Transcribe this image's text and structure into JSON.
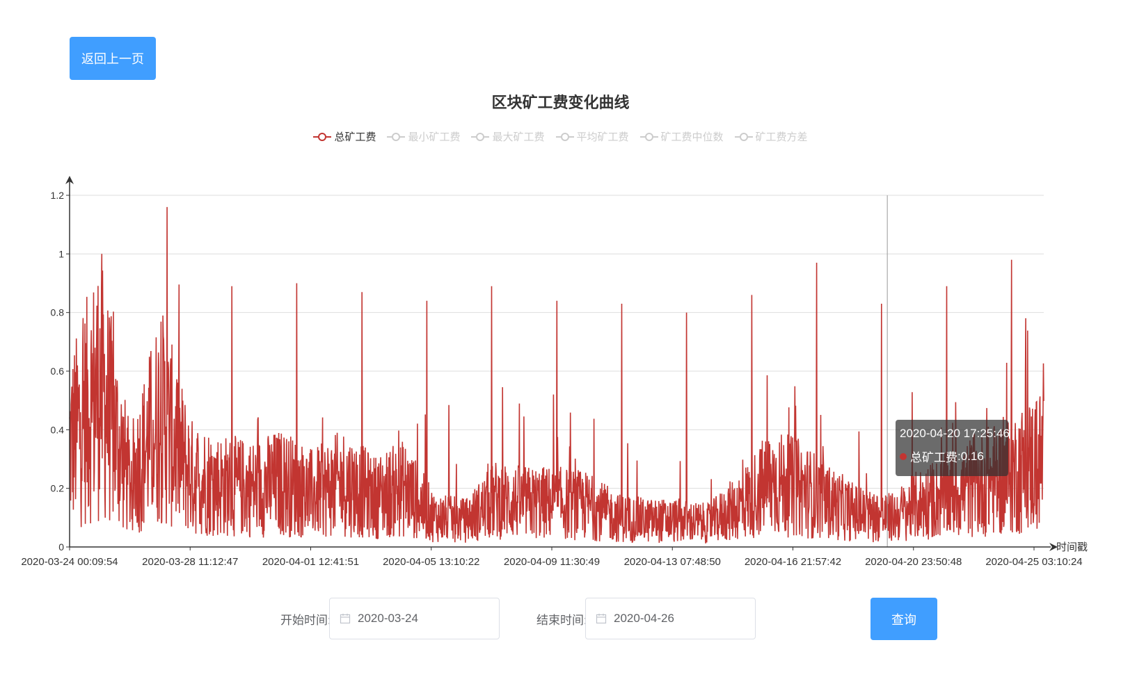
{
  "back_button": {
    "label": "返回上一页"
  },
  "legend": [
    {
      "label": "总矿工费",
      "active": true
    },
    {
      "label": "最小矿工费",
      "active": false
    },
    {
      "label": "最大矿工费",
      "active": false
    },
    {
      "label": "平均矿工费",
      "active": false
    },
    {
      "label": "矿工费中位数",
      "active": false
    },
    {
      "label": "矿工费方差",
      "active": false
    }
  ],
  "tooltip": {
    "time": "2020-04-20 17:25:46",
    "series": "总矿工费",
    "value": "0.16"
  },
  "filter": {
    "start_label": "开始时间:",
    "start_value": "2020-03-24",
    "end_label": "结束时间:",
    "end_value": "2020-04-26",
    "query_label": "查询"
  },
  "colors": {
    "series": "#c23531",
    "primary": "#409eff"
  },
  "chart_data": {
    "type": "line",
    "title": "区块矿工费变化曲线",
    "xlabel": "时间戳",
    "ylabel": "",
    "ylim": [
      0,
      1.2
    ],
    "yticks": [
      "0",
      "0.2",
      "0.4",
      "0.6",
      "0.8",
      "1",
      "1.2"
    ],
    "xticks": [
      "2020-03-24 00:09:54",
      "2020-03-28 11:12:47",
      "2020-04-01 12:41:51",
      "2020-04-05 13:10:22",
      "2020-04-09 11:30:49",
      "2020-04-13 07:48:50",
      "2020-04-16 21:57:42",
      "2020-04-20 23:50:48",
      "2020-04-25 03:10:24"
    ],
    "grid": true,
    "legend_position": "top-center",
    "series": [
      {
        "name": "总矿工费",
        "x": [
          "2020-03-24",
          "2020-03-25",
          "2020-03-26",
          "2020-03-27",
          "2020-03-28",
          "2020-03-29",
          "2020-03-30",
          "2020-03-31",
          "2020-04-01",
          "2020-04-02",
          "2020-04-03",
          "2020-04-04",
          "2020-04-05",
          "2020-04-06",
          "2020-04-07",
          "2020-04-08",
          "2020-04-09",
          "2020-04-10",
          "2020-04-11",
          "2020-04-12",
          "2020-04-13",
          "2020-04-14",
          "2020-04-15",
          "2020-04-16",
          "2020-04-17",
          "2020-04-18",
          "2020-04-19",
          "2020-04-20",
          "2020-04-21",
          "2020-04-22",
          "2020-04-23",
          "2020-04-24",
          "2020-04-25"
        ],
        "values": [
          0.35,
          0.55,
          0.22,
          0.45,
          0.24,
          0.21,
          0.2,
          0.22,
          0.18,
          0.22,
          0.17,
          0.2,
          0.1,
          0.09,
          0.16,
          0.15,
          0.15,
          0.14,
          0.1,
          0.09,
          0.09,
          0.08,
          0.14,
          0.22,
          0.2,
          0.15,
          0.11,
          0.1,
          0.15,
          0.18,
          0.22,
          0.25,
          0.3
        ],
        "peaks": [
          1.0,
          1.16,
          0.89,
          0.9,
          0.87,
          0.84,
          0.89,
          0.84,
          0.83,
          0.8,
          0.86,
          0.97,
          0.83,
          0.89,
          0.98
        ]
      }
    ]
  }
}
